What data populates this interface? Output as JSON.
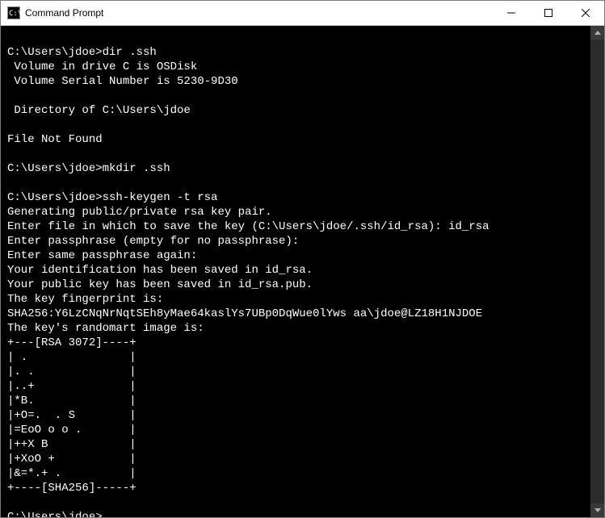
{
  "window": {
    "title": "Command Prompt"
  },
  "terminal": {
    "lines": [
      "",
      "C:\\Users\\jdoe>dir .ssh",
      " Volume in drive C is OSDisk",
      " Volume Serial Number is 5230-9D30",
      "",
      " Directory of C:\\Users\\jdoe",
      "",
      "File Not Found",
      "",
      "C:\\Users\\jdoe>mkdir .ssh",
      "",
      "C:\\Users\\jdoe>ssh-keygen -t rsa",
      "Generating public/private rsa key pair.",
      "Enter file in which to save the key (C:\\Users\\jdoe/.ssh/id_rsa): id_rsa",
      "Enter passphrase (empty for no passphrase):",
      "Enter same passphrase again:",
      "Your identification has been saved in id_rsa.",
      "Your public key has been saved in id_rsa.pub.",
      "The key fingerprint is:",
      "SHA256:Y6LzCNqNrNqtSEh8yMae64kaslYs7UBp0DqWue0lYws aa\\jdoe@LZ18H1NJDOE",
      "The key's randomart image is:",
      "+---[RSA 3072]----+",
      "| .               |",
      "|. .              |",
      "|..+              |",
      "|*B.              |",
      "|+O=.  . S        |",
      "|=EoO o o .       |",
      "|++X B            |",
      "|+XoO +           |",
      "|&=*.+ .          |",
      "+----[SHA256]-----+",
      "",
      "C:\\Users\\jdoe>"
    ]
  }
}
